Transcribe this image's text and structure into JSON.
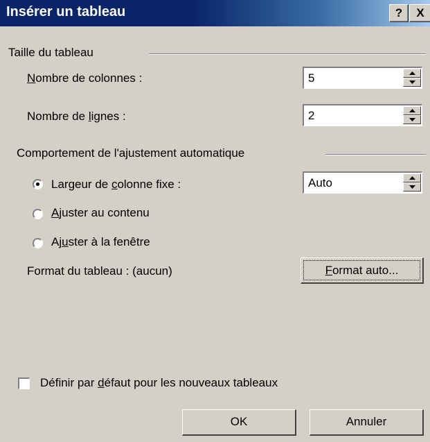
{
  "window": {
    "title": "Insérer un tableau",
    "help_label": "?",
    "close_label": "X"
  },
  "table_size": {
    "group_label": "Taille du tableau",
    "columns_label_mnemonic": "N",
    "columns_label_rest": "ombre de colonnes :",
    "columns_value": "5",
    "rows_label_pre": "Nombre de ",
    "rows_label_mnemonic": "l",
    "rows_label_post": "ignes :",
    "rows_value": "2"
  },
  "autofit": {
    "group_label": "Comportement de l'ajustement automatique",
    "fixed_label_pre": "Largeur de ",
    "fixed_label_mnemonic": "c",
    "fixed_label_post": "olonne fixe :",
    "fixed_value": "Auto",
    "fixed_selected": true,
    "content_label_mnemonic": "A",
    "content_label_rest": "juster au contenu",
    "window_label_pre": "Aj",
    "window_label_mnemonic": "u",
    "window_label_post": "ster à la fenêtre",
    "format_label": "Format du tableau : (aucun)",
    "format_button_mnemonic": "F",
    "format_button_rest": "ormat auto..."
  },
  "default": {
    "label_pre": "Définir par ",
    "label_mnemonic": "d",
    "label_post": "éfaut pour les nouveaux tableaux",
    "checked": false
  },
  "buttons": {
    "ok_label": "OK",
    "cancel_label": "Annuler"
  },
  "colors": {
    "title_bar": "#0a246a",
    "dialog_bg": "#d4d0c8"
  }
}
